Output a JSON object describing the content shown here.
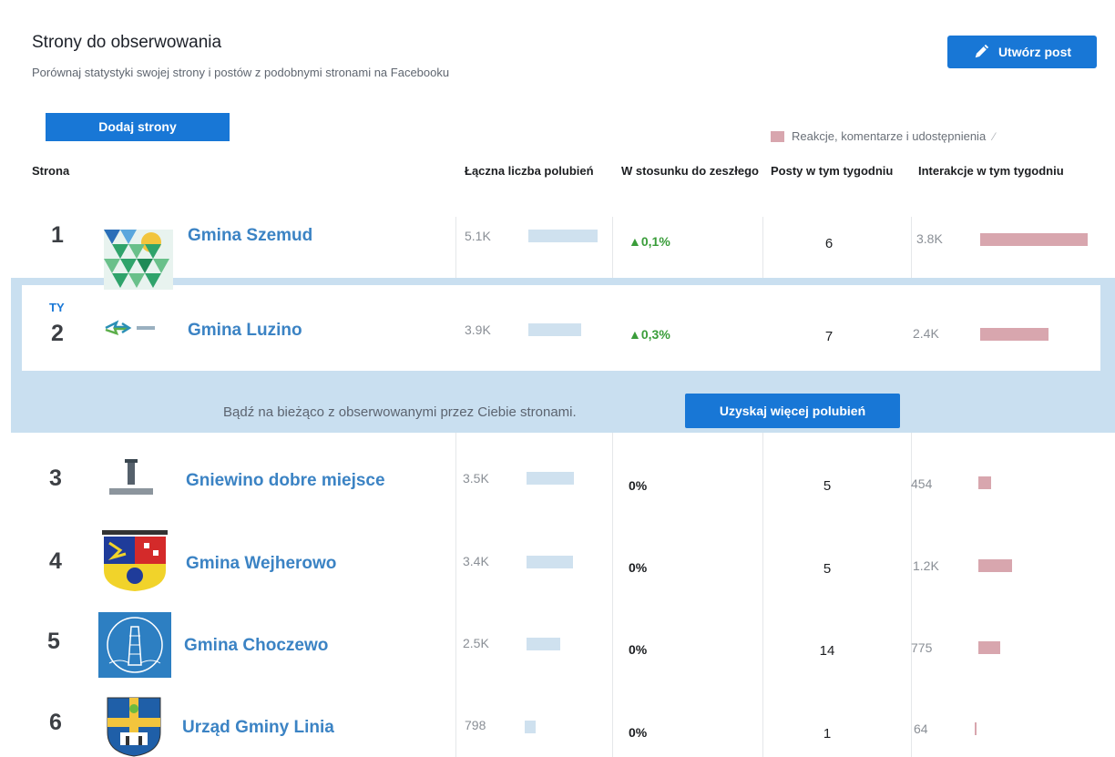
{
  "header": {
    "title": "Strony do obserwowania",
    "subtitle": "Porównaj statystyki swojej strony i postów z podobnymi stronami na Facebooku",
    "create_post_label": "Utwórz post"
  },
  "add_pages_label": "Dodaj strony",
  "legend_label": "Reakcje, komentarze i udostępnienia",
  "columns": {
    "page": "Strona",
    "likes": "Łączna liczba polubień",
    "change": "W stosunku do zeszłego tygodnia",
    "posts": "Posty w tym tygodniu",
    "interactions": "Interakcje w tym tygodniu"
  },
  "you_label": "TY",
  "band": {
    "text": "Bądź na bieżąco z obserwowanymi przez Ciebie stronami.",
    "button_label": "Uzyskaj więcej polubień"
  },
  "colors": {
    "accent": "#1877d6",
    "link": "#3b83c4",
    "likes_bar": "#cfe1ef",
    "interactions_bar": "#d8a6ae",
    "positive": "#3a9d3a",
    "band": "#c9dff0"
  },
  "rows": [
    {
      "rank": "1",
      "name": "Gmina Szemud",
      "likes": "5.1K",
      "likes_value": 5100,
      "change": "0,1%",
      "change_up": true,
      "posts": "6",
      "interactions": "3.8K",
      "interactions_value": 3800,
      "logo": "triangle-mosaic-logo"
    },
    {
      "rank": "2",
      "name": "Gmina Luzino",
      "likes": "3.9K",
      "likes_value": 3900,
      "change": "0,3%",
      "change_up": true,
      "posts": "7",
      "interactions": "2.4K",
      "interactions_value": 2400,
      "logo": "luzino-logo",
      "is_you": true
    },
    {
      "rank": "3",
      "name": "Gniewino dobre miejsce",
      "likes": "3.5K",
      "likes_value": 3500,
      "change": "0%",
      "change_up": false,
      "posts": "5",
      "interactions": "454",
      "interactions_value": 454,
      "logo": "gniewino-logo"
    },
    {
      "rank": "4",
      "name": "Gmina Wejherowo",
      "likes": "3.4K",
      "likes_value": 3400,
      "change": "0%",
      "change_up": false,
      "posts": "5",
      "interactions": "1.2K",
      "interactions_value": 1200,
      "logo": "coat-of-arms-logo"
    },
    {
      "rank": "5",
      "name": "Gmina Choczewo",
      "likes": "2.5K",
      "likes_value": 2500,
      "change": "0%",
      "change_up": false,
      "posts": "14",
      "interactions": "775",
      "interactions_value": 775,
      "logo": "lighthouse-logo"
    },
    {
      "rank": "6",
      "name": "Urząd Gminy Linia",
      "likes": "798",
      "likes_value": 798,
      "change": "0%",
      "change_up": false,
      "posts": "1",
      "interactions": "64",
      "interactions_value": 64,
      "logo": "shield-crest-logo"
    }
  ]
}
